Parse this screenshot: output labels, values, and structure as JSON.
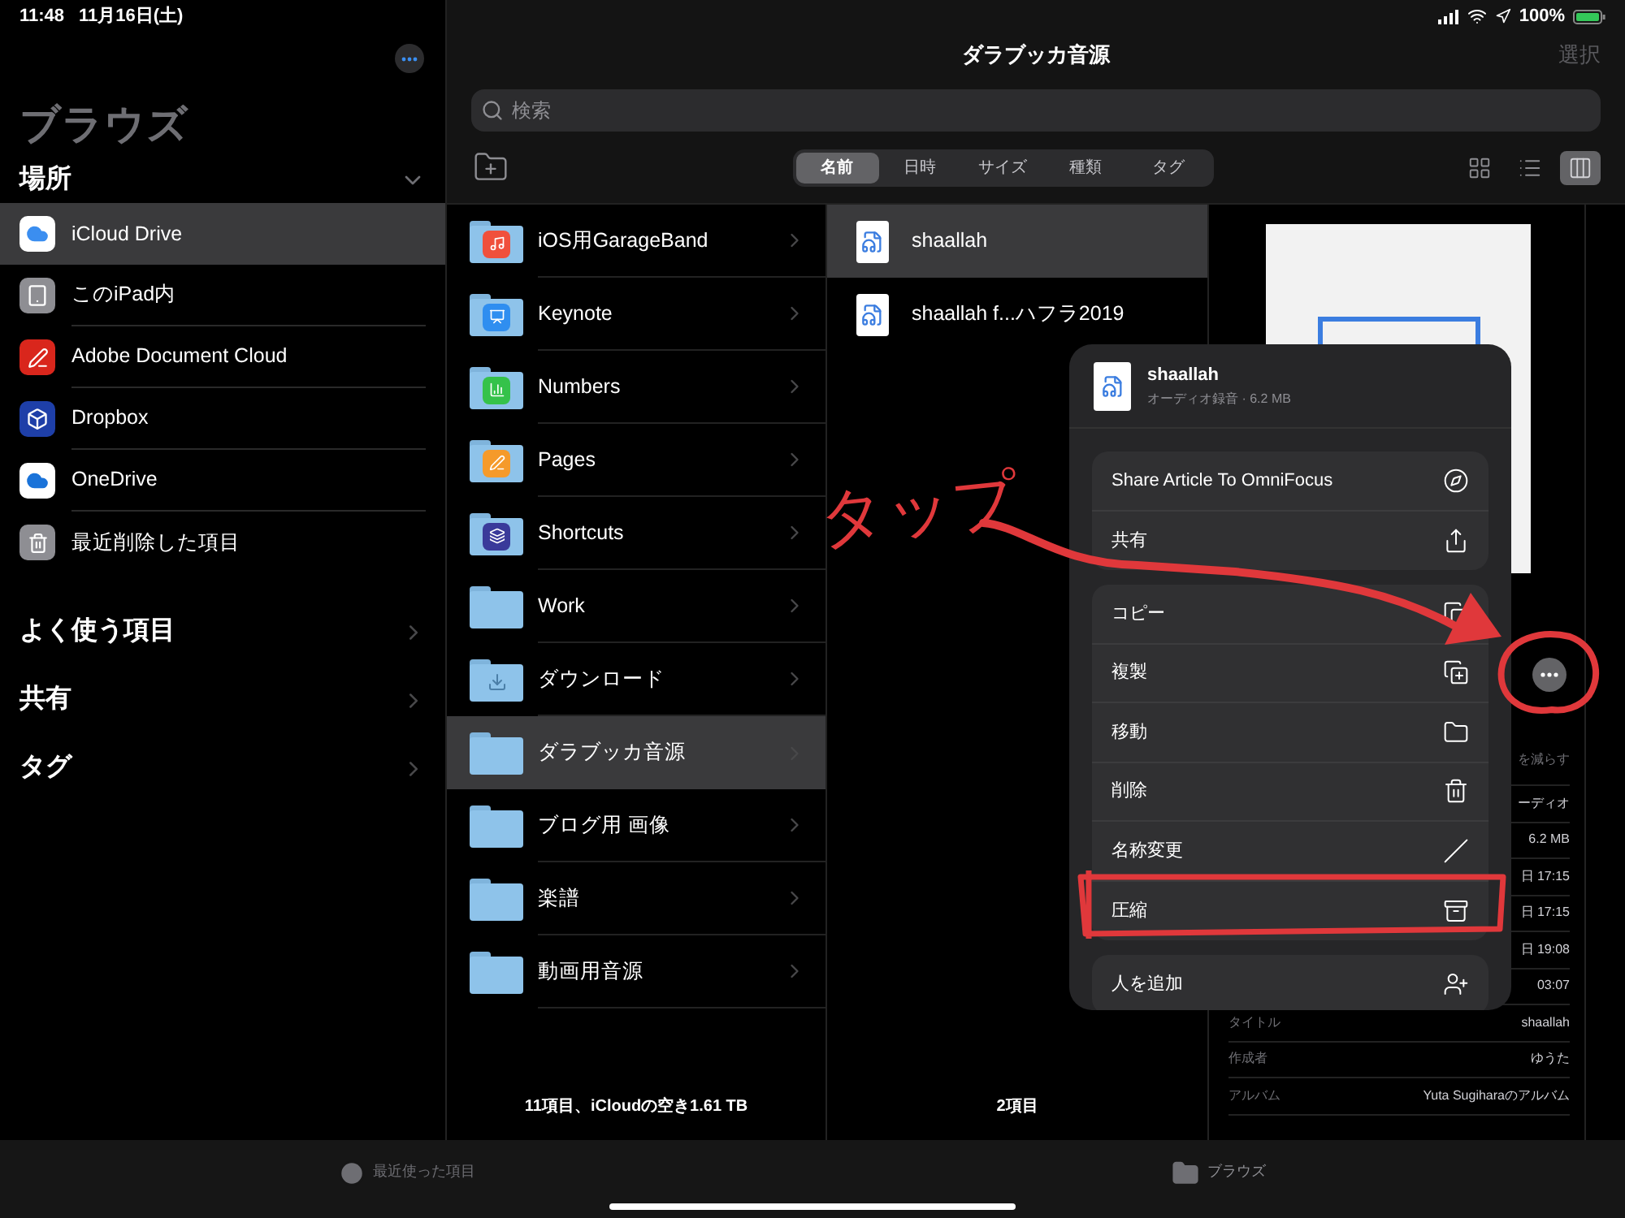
{
  "status_bar": {
    "time": "11:48",
    "date": "11月16日(土)",
    "battery": "100%"
  },
  "sidebar": {
    "title": "ブラウズ",
    "locations_header": {
      "label": "場所",
      "expanded": true
    },
    "locations": [
      {
        "label": "iCloud Drive",
        "kind": "icloud",
        "selected": true
      },
      {
        "label": "このiPad内",
        "kind": "ipad",
        "selected": false
      },
      {
        "label": "Adobe Document Cloud",
        "kind": "adobe",
        "selected": false
      },
      {
        "label": "Dropbox",
        "kind": "dropbox",
        "selected": false
      },
      {
        "label": "OneDrive",
        "kind": "onedrive",
        "selected": false
      },
      {
        "label": "最近削除した項目",
        "kind": "trash",
        "selected": false
      }
    ],
    "sections": [
      {
        "label": "よく使う項目"
      },
      {
        "label": "共有"
      },
      {
        "label": "タグ"
      }
    ]
  },
  "header": {
    "title": "ダラブッカ音源",
    "select_button": "選択",
    "search": {
      "placeholder": "検索"
    }
  },
  "sort_tabs": [
    {
      "label": "名前",
      "selected": true
    },
    {
      "label": "日時",
      "selected": false
    },
    {
      "label": "サイズ",
      "selected": false
    },
    {
      "label": "種類",
      "selected": false
    },
    {
      "label": "タグ",
      "selected": false
    }
  ],
  "view_modes": [
    {
      "kind": "grid",
      "selected": false
    },
    {
      "kind": "list",
      "selected": false
    },
    {
      "kind": "columns",
      "selected": true
    }
  ],
  "folders": [
    {
      "label": "iOS用GarageBand",
      "kind": "garageband",
      "selected": false
    },
    {
      "label": "Keynote",
      "kind": "keynote",
      "selected": false
    },
    {
      "label": "Numbers",
      "kind": "numbers",
      "selected": false
    },
    {
      "label": "Pages",
      "kind": "pages",
      "selected": false
    },
    {
      "label": "Shortcuts",
      "kind": "shortcuts",
      "selected": false
    },
    {
      "label": "Work",
      "kind": "plain",
      "selected": false
    },
    {
      "label": "ダウンロード",
      "kind": "download",
      "selected": false
    },
    {
      "label": "ダラブッカ音源",
      "kind": "plain",
      "selected": true
    },
    {
      "label": "ブログ用 画像",
      "kind": "plain",
      "selected": false
    },
    {
      "label": "楽譜",
      "kind": "plain",
      "selected": false
    },
    {
      "label": "動画用音源",
      "kind": "plain",
      "selected": false
    }
  ],
  "folders_footer": "11項目、iCloudの空き1.61 TB",
  "files": [
    {
      "label": "shaallah",
      "selected": true
    },
    {
      "label": "shaallah f...ハフラ2019",
      "selected": false
    }
  ],
  "files_footer": "2項目",
  "details": [
    {
      "kind": "action",
      "value": "を減らす"
    },
    {
      "kind": "info",
      "value": "ーディオ"
    },
    {
      "kind": "info",
      "value": "6.2 MB"
    },
    {
      "kind": "info",
      "value": "日 17:15"
    },
    {
      "kind": "info",
      "value": "日 17:15"
    },
    {
      "kind": "info",
      "value": "日 19:08"
    },
    {
      "kind": "info",
      "value": "03:07"
    },
    {
      "kind": "info",
      "label": "タイトル",
      "value": "shaallah"
    },
    {
      "kind": "info",
      "label": "作成者",
      "value": "ゆうた"
    },
    {
      "kind": "info",
      "label": "アルバム",
      "value": "Yuta Sugiharaのアルバム"
    }
  ],
  "context_menu": {
    "file_name": "shaallah",
    "file_info": "オーディオ録音 · 6.2 MB",
    "groups": [
      [
        {
          "label": "Share Article To OmniFocus",
          "kind": "compass"
        },
        {
          "label": "共有",
          "kind": "share"
        }
      ],
      [
        {
          "label": "コピー",
          "kind": "copy"
        },
        {
          "label": "複製",
          "kind": "duplicate"
        },
        {
          "label": "移動",
          "kind": "move"
        },
        {
          "label": "削除",
          "kind": "delete"
        },
        {
          "label": "名称変更",
          "kind": "rename"
        },
        {
          "label": "圧縮",
          "kind": "compress"
        }
      ],
      [
        {
          "label": "人を追加",
          "kind": "addperson"
        }
      ]
    ]
  },
  "annotation": {
    "label": "タップ"
  },
  "tab_bar": [
    {
      "label": "最近使った項目",
      "kind": "recents",
      "selected": false
    },
    {
      "label": "ブラウズ",
      "kind": "browse",
      "selected": true
    }
  ]
}
